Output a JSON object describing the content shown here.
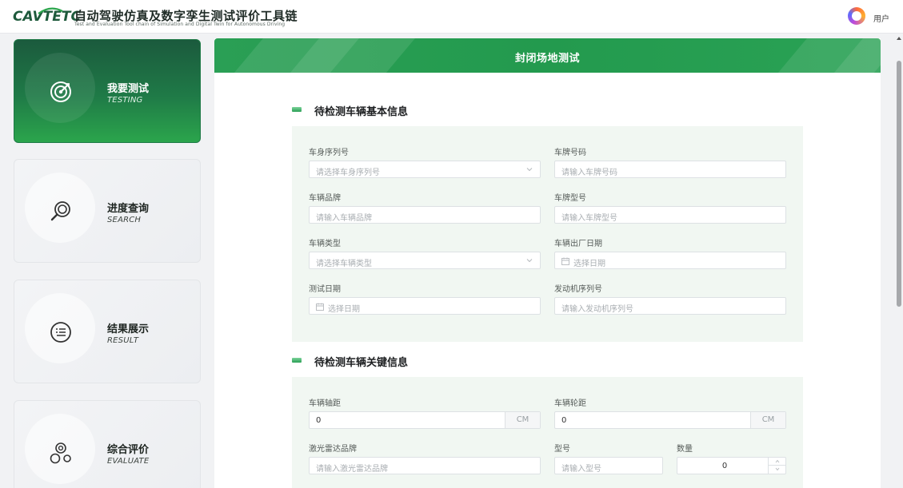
{
  "header": {
    "brand": "CAVTETC",
    "title": "自动驾驶仿真及数字孪生测试评价工具链",
    "subtitle": "Test and Evaluation Tool chain of Simulation and Digital Twin for Autonomous Driving",
    "user_label": "用户"
  },
  "sidebar": {
    "items": [
      {
        "title": "我要测试",
        "sub": "TESTING",
        "active": true
      },
      {
        "title": "进度查询",
        "sub": "SEARCH",
        "active": false
      },
      {
        "title": "结果展示",
        "sub": "RESULT",
        "active": false
      },
      {
        "title": "综合评价",
        "sub": "EVALUATE",
        "active": false
      }
    ]
  },
  "main": {
    "banner_title": "封闭场地测试",
    "section1": {
      "title": "待检测车辆基本信息",
      "fields": {
        "vin": {
          "label": "车身序列号",
          "placeholder": "请选择车身序列号"
        },
        "plate_no": {
          "label": "车牌号码",
          "placeholder": "请输入车牌号码"
        },
        "brand": {
          "label": "车辆品牌",
          "placeholder": "请输入车辆品牌"
        },
        "plate_model": {
          "label": "车牌型号",
          "placeholder": "请输入车牌型号"
        },
        "vehicle_type": {
          "label": "车辆类型",
          "placeholder": "请选择车辆类型"
        },
        "mfg_date": {
          "label": "车辆出厂日期",
          "placeholder": "选择日期"
        },
        "test_date": {
          "label": "测试日期",
          "placeholder": "选择日期"
        },
        "engine_no": {
          "label": "发动机序列号",
          "placeholder": "请输入发动机序列号"
        }
      }
    },
    "section2": {
      "title": "待检测车辆关键信息",
      "fields": {
        "wheelbase": {
          "label": "车辆轴距",
          "value": "0",
          "unit": "CM"
        },
        "track": {
          "label": "车辆轮距",
          "value": "0",
          "unit": "CM"
        },
        "lidar_brand": {
          "label": "激光雷达品牌",
          "placeholder": "请输入激光雷达品牌"
        },
        "model": {
          "label": "型号",
          "placeholder": "请输入型号"
        },
        "quantity": {
          "label": "数量",
          "value": "0"
        }
      }
    }
  }
}
